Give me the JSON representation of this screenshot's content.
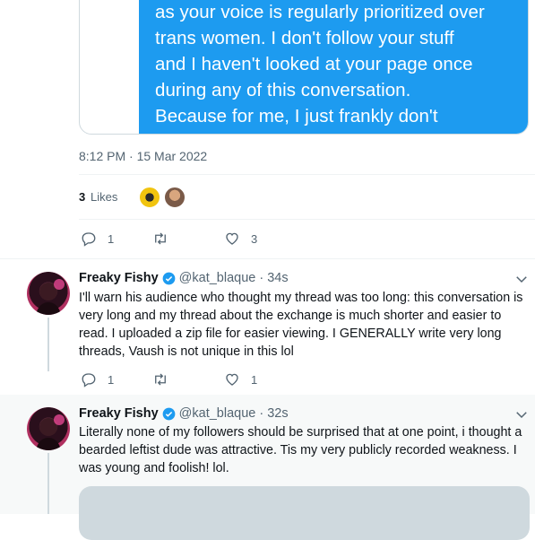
{
  "embedded_message": {
    "lines": [
      "as your voice is regularly prioritized over",
      "trans women. I don't follow your stuff",
      "and I haven't looked at your page once",
      "during any of this conversation.",
      "Because for me, I just frankly don't"
    ],
    "bubble_color": "#1d9bf0"
  },
  "main_tweet": {
    "timestamp": "8:12 PM · 15 Mar 2022",
    "likes_count": "3",
    "likes_label": "Likes",
    "actions": {
      "reply_count": "1",
      "retweet_count": "",
      "like_count": "3"
    }
  },
  "replies": [
    {
      "name": "Freaky Fishy",
      "handle": "@kat_blaque",
      "time": "· 34s",
      "text": "I'll warn his audience who thought my thread was too long: this conversation is very long and my thread about the exchange is much shorter and easier to read. I uploaded a zip file for easier viewing. I GENERALLY write very long threads, Vaush is not unique in this lol",
      "reply_count": "1",
      "retweet_count": "",
      "like_count": "1"
    },
    {
      "name": "Freaky Fishy",
      "handle": "@kat_blaque",
      "time": "· 32s",
      "text": "Literally none of my followers should be surprised that at one point, i thought a bearded leftist dude was attractive. Tis my very publicly recorded weakness. I was young and foolish! lol."
    }
  ],
  "colors": {
    "accent": "#1d9bf0",
    "secondary_text": "#536471",
    "divider": "#eff3f4",
    "verified": "#1d9bf0"
  },
  "icons": [
    "reply-icon",
    "retweet-icon",
    "like-icon",
    "verified-badge-icon",
    "chevron-down-icon"
  ]
}
